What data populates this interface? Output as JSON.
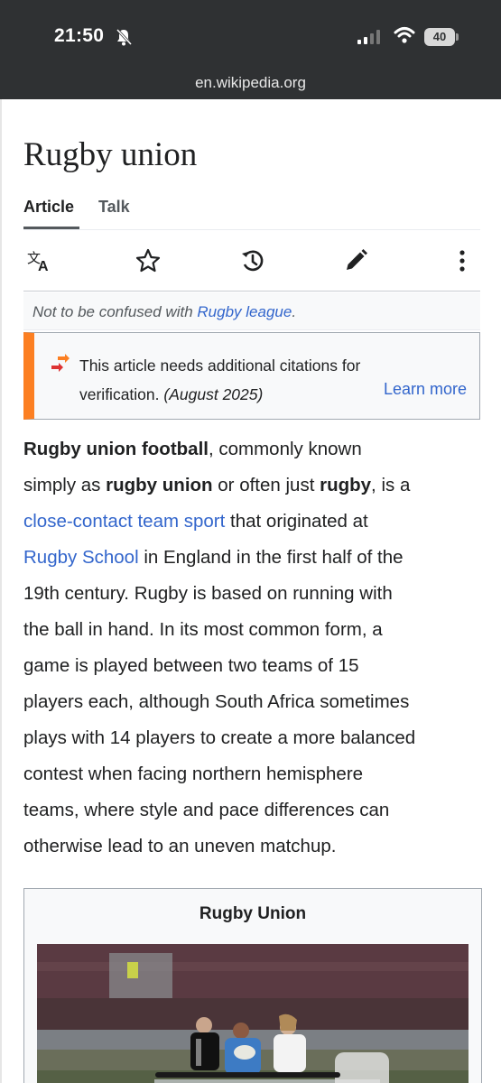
{
  "status_bar": {
    "time": "21:50",
    "battery": "40",
    "url": "en.wikipedia.org"
  },
  "article": {
    "title": "Rugby union",
    "tabs": [
      "Article",
      "Talk"
    ],
    "toolbar_icons": [
      "translate-icon",
      "watch-star-icon",
      "history-icon",
      "edit-pencil-icon",
      "more-menu-icon"
    ],
    "hatnote": {
      "prefix": "Not to be confused with ",
      "link": "Rugby league",
      "suffix": "."
    },
    "notice": {
      "line1": "This article needs additional citations for",
      "line2": "verification.",
      "date": "(August 2025)",
      "learn_more": "Learn more"
    },
    "lead": {
      "b1": "Rugby union football",
      "t1": ", commonly known",
      "t2": "simply as ",
      "b2": "rugby union",
      "t3": " or often just ",
      "b3": "rugby",
      "t4": ", is a",
      "link1": "close-contact team sport",
      "t5": " that originated at",
      "link2": "Rugby School",
      "t6": " in England in the first half of the",
      "l4": "19th century. Rugby is based on running with",
      "l5": "the ball in hand. In its most common form, a",
      "l6": "game is played between two teams of 15",
      "l7": "players each, although South Africa sometimes",
      "l8": "plays with 14 players to create a more balanced",
      "l9": "contest when facing northern hemisphere",
      "l10": "teams, where style and pace differences can",
      "l11": "otherwise lead to an uneven matchup."
    },
    "infobox": {
      "title": "Rugby Union"
    }
  },
  "colors": {
    "link": "#3366cc",
    "notice_accent": "#fc7f22",
    "status_bar_bg": "#2f3133"
  }
}
